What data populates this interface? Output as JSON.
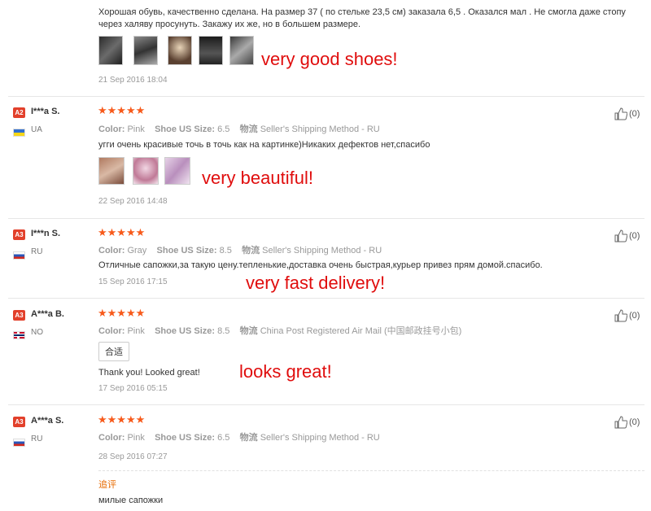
{
  "review0": {
    "text": "Хорошая обувь, качественно сделана. На размер 37 ( по стельке 23,5 см) заказала 6,5 . Оказался мал . Не смогла даже стопу",
    "text2": "через халяву просунуть. Закажу их же, но в большем размере.",
    "annotation": "very good shoes!",
    "date": "21 Sep 2016 18:04"
  },
  "reviews": [
    {
      "badge": "A2",
      "name": "I***a S.",
      "country": "UA",
      "stars": "★★★★★",
      "color_label": "Color:",
      "color": "Pink",
      "size_label": "Shoe US Size:",
      "size": "6.5",
      "ship_label": "物流",
      "ship": "Seller's Shipping Method - RU",
      "text": "угги очень красивые точь в точь как на картинке)Никаких дефектов нет,спасибо",
      "annotation": "very beautiful!",
      "date": "22 Sep 2016 14:48",
      "likes": "(0)"
    },
    {
      "badge": "A3",
      "name": "I***n S.",
      "country": "RU",
      "stars": "★★★★★",
      "color_label": "Color:",
      "color": "Gray",
      "size_label": "Shoe US Size:",
      "size": "8.5",
      "ship_label": "物流",
      "ship": "Seller's Shipping Method - RU",
      "text": "Отличные сапожки,за такую цену.тепленькие,доставка очень быстрая,курьер привез прям домой.спасибо.",
      "annotation": "very fast delivery!",
      "date": "15 Sep 2016 17:15",
      "likes": "(0)"
    },
    {
      "badge": "A3",
      "name": "A***a B.",
      "country": "NO",
      "stars": "★★★★★",
      "color_label": "Color:",
      "color": "Pink",
      "size_label": "Shoe US Size:",
      "size": "8.5",
      "ship_label": "物流",
      "ship": "China Post Registered Air Mail (中国邮政挂号小包)",
      "tag": "合适",
      "text": "Thank you! Looked great!",
      "annotation": "looks great!",
      "date": "17 Sep 2016 05:15",
      "likes": "(0)"
    },
    {
      "badge": "A3",
      "name": "A***a S.",
      "country": "RU",
      "stars": "★★★★★",
      "color_label": "Color:",
      "color": "Pink",
      "size_label": "Shoe US Size:",
      "size": "6.5",
      "ship_label": "物流",
      "ship": "Seller's Shipping Method - RU",
      "date": "28 Sep 2016 07:27",
      "likes": "(0)",
      "followup_label": "追评",
      "followup_text": "милые сапожки"
    }
  ],
  "colors": {
    "star": "#f75a1b",
    "annotation": "#e00d0d",
    "badge": "#e2402b"
  }
}
